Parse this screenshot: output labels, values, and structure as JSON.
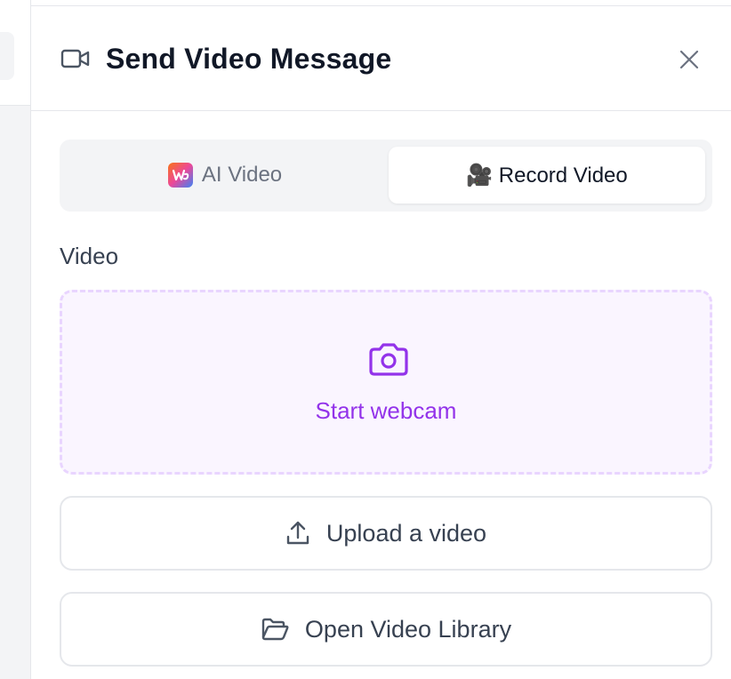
{
  "dialog": {
    "title": "Send Video Message",
    "icons": {
      "header": "video-camera-icon",
      "close": "close-icon"
    }
  },
  "tabs": [
    {
      "label": "AI Video",
      "icon": "ai-video-app-icon",
      "active": false
    },
    {
      "label": "🎥 Record Video",
      "icon": "movie-camera-emoji",
      "active": true
    }
  ],
  "video": {
    "label": "Video",
    "webcam": {
      "label": "Start webcam",
      "icon": "camera-icon"
    }
  },
  "buttons": {
    "upload": {
      "label": "Upload a video",
      "icon": "upload-icon"
    },
    "library": {
      "label": "Open Video Library",
      "icon": "folder-open-icon"
    }
  },
  "colors": {
    "accent_purple": "#9333ea",
    "dropzone_bg": "#faf5ff",
    "dropzone_border": "#e9d5ff",
    "tab_track": "#f3f4f6",
    "border": "#e5e7eb"
  }
}
